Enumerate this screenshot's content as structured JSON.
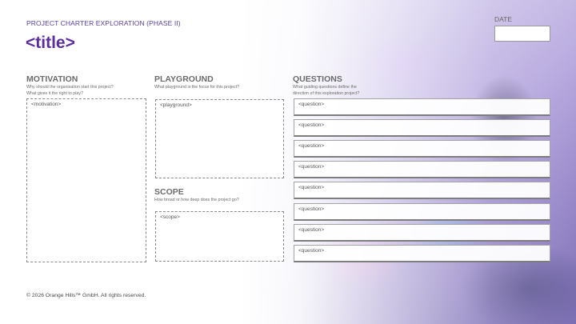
{
  "header": {
    "eyebrow": "PROJECT CHARTER EXPLORATION (PHASE II)",
    "title": "<title>",
    "date_label": "DATE"
  },
  "motivation": {
    "title": "MOTIVATION",
    "subtitle_line1": "Why should the organisation start this project?",
    "subtitle_line2": "What gives it the right to play?",
    "placeholder": "<motivation>"
  },
  "playground": {
    "title": "PLAYGROUND",
    "subtitle": "What playground is the focus for this project?",
    "placeholder": "<playground>"
  },
  "scope": {
    "title": "SCOPE",
    "subtitle": "How broad or how deep does the project go?",
    "placeholder": "<scope>"
  },
  "questions": {
    "title": "QUESTIONS",
    "subtitle_line1": "What guiding questions define the",
    "subtitle_line2": "direction of this exploration project?",
    "items": [
      "<question>",
      "<question>",
      "<question>",
      "<question>",
      "<question>",
      "<question>",
      "<question>",
      "<question>"
    ]
  },
  "footer": {
    "copyright": "© 2026 Orange Hills™ GmbH. All rights reserved."
  },
  "colors": {
    "accent": "#5b2d9f",
    "eyebrow": "#5b3fa0"
  }
}
